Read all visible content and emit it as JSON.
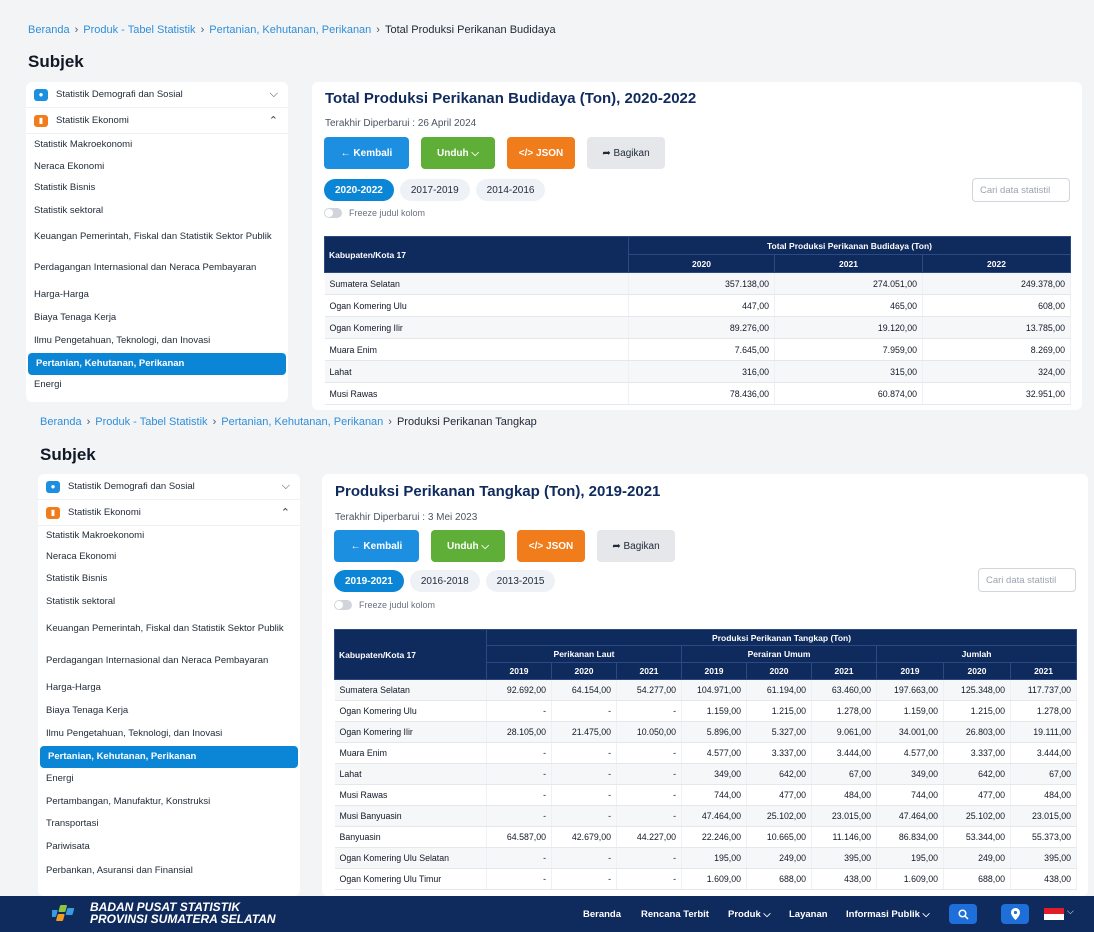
{
  "views": [
    {
      "breadcrumb": {
        "home": "Beranda",
        "products": "Produk - Tabel Statistik",
        "subject": "Pertanian, Kehutanan, Perikanan",
        "current": "Total Produksi Perikanan Budidaya"
      },
      "subject_heading": "Subjek",
      "sidebar": {
        "categories": [
          {
            "label": "Statistik Demografi dan Sosial",
            "icon": "people-icon",
            "chevron": "chevron-down-icon",
            "color": "#1d8fe0"
          },
          {
            "label": "Statistik Ekonomi",
            "icon": "chart-icon",
            "chevron": "chevron-up-icon",
            "color": "#f07c1b"
          }
        ],
        "items": [
          "Statistik Makroekonomi",
          "Neraca Ekonomi",
          "Statistik Bisnis",
          "Statistik sektoral",
          "Keuangan Pemerintah, Fiskal dan Statistik Sektor Publik",
          "Perdagangan Internasional dan Neraca Pembayaran",
          "Harga-Harga",
          "Biaya Tenaga Kerja",
          "Ilmu Pengetahuan, Teknologi, dan Inovasi",
          "Pertanian, Kehutanan, Perikanan",
          "Energi"
        ],
        "active_index": 9
      },
      "table_title": "Total Produksi Perikanan Budidaya (Ton), 2020-2022",
      "updated": "Terakhir Diperbarui : 26 April 2024",
      "buttons": {
        "back": "← Kembali",
        "download": "Unduh ⌵",
        "json": "</> JSON",
        "share": "➦ Bagikan"
      },
      "ranges": [
        "2020-2022",
        "2017-2019",
        "2014-2016"
      ],
      "freeze_label": "Freeze judul kolom",
      "search_placeholder": "Cari data statistil",
      "table": {
        "row_header": "Kabupaten/Kota 17",
        "group_header": "Total Produksi Perikanan Budidaya (Ton)",
        "years": [
          "2020",
          "2021",
          "2022"
        ],
        "rows": [
          [
            "Sumatera Selatan",
            "357.138,00",
            "274.051,00",
            "249.378,00"
          ],
          [
            "Ogan Komering Ulu",
            "447,00",
            "465,00",
            "608,00"
          ],
          [
            "Ogan Komering Ilir",
            "89.276,00",
            "19.120,00",
            "13.785,00"
          ],
          [
            "Muara Enim",
            "7.645,00",
            "7.959,00",
            "8.269,00"
          ],
          [
            "Lahat",
            "316,00",
            "315,00",
            "324,00"
          ],
          [
            "Musi Rawas",
            "78.436,00",
            "60.874,00",
            "32.951,00"
          ]
        ]
      }
    },
    {
      "breadcrumb": {
        "home": "Beranda",
        "products": "Produk - Tabel Statistik",
        "subject": "Pertanian, Kehutanan, Perikanan",
        "current": "Produksi Perikanan Tangkap"
      },
      "subject_heading": "Subjek",
      "sidebar": {
        "categories": [
          {
            "label": "Statistik Demografi dan Sosial",
            "icon": "people-icon",
            "chevron": "chevron-down-icon",
            "color": "#1d8fe0"
          },
          {
            "label": "Statistik Ekonomi",
            "icon": "chart-icon",
            "chevron": "chevron-up-icon",
            "color": "#f07c1b"
          }
        ],
        "items": [
          "Statistik Makroekonomi",
          "Neraca Ekonomi",
          "Statistik Bisnis",
          "Statistik sektoral",
          "Keuangan Pemerintah, Fiskal dan Statistik Sektor Publik",
          "Perdagangan Internasional dan Neraca Pembayaran",
          "Harga-Harga",
          "Biaya Tenaga Kerja",
          "Ilmu Pengetahuan, Teknologi, dan Inovasi",
          "Pertanian, Kehutanan, Perikanan",
          "Energi",
          "Pertambangan, Manufaktur, Konstruksi",
          "Transportasi",
          "Pariwisata",
          "Perbankan, Asuransi dan Finansial"
        ],
        "active_index": 9
      },
      "table_title": "Produksi Perikanan Tangkap (Ton), 2019-2021",
      "updated": "Terakhir Diperbarui : 3 Mei 2023",
      "buttons": {
        "back": "← Kembali",
        "download": "Unduh ⌵",
        "json": "</> JSON",
        "share": "➦ Bagikan"
      },
      "ranges": [
        "2019-2021",
        "2016-2018",
        "2013-2015"
      ],
      "freeze_label": "Freeze judul kolom",
      "search_placeholder": "Cari data statistil",
      "table": {
        "row_header": "Kabupaten/Kota 17",
        "group_header": "Produksi Perikanan Tangkap (Ton)",
        "subgroups": [
          "Perikanan Laut",
          "Perairan Umum",
          "Jumlah"
        ],
        "years": [
          "2019",
          "2020",
          "2021"
        ],
        "rows": [
          [
            "Sumatera Selatan",
            "92.692,00",
            "64.154,00",
            "54.277,00",
            "104.971,00",
            "61.194,00",
            "63.460,00",
            "197.663,00",
            "125.348,00",
            "117.737,00"
          ],
          [
            "Ogan Komering Ulu",
            "-",
            "-",
            "-",
            "1.159,00",
            "1.215,00",
            "1.278,00",
            "1.159,00",
            "1.215,00",
            "1.278,00"
          ],
          [
            "Ogan Komering Ilir",
            "28.105,00",
            "21.475,00",
            "10.050,00",
            "5.896,00",
            "5.327,00",
            "9.061,00",
            "34.001,00",
            "26.803,00",
            "19.111,00"
          ],
          [
            "Muara Enim",
            "-",
            "-",
            "-",
            "4.577,00",
            "3.337,00",
            "3.444,00",
            "4.577,00",
            "3.337,00",
            "3.444,00"
          ],
          [
            "Lahat",
            "-",
            "-",
            "-",
            "349,00",
            "642,00",
            "67,00",
            "349,00",
            "642,00",
            "67,00"
          ],
          [
            "Musi Rawas",
            "-",
            "-",
            "-",
            "744,00",
            "477,00",
            "484,00",
            "744,00",
            "477,00",
            "484,00"
          ],
          [
            "Musi Banyuasin",
            "-",
            "-",
            "-",
            "47.464,00",
            "25.102,00",
            "23.015,00",
            "47.464,00",
            "25.102,00",
            "23.015,00"
          ],
          [
            "Banyuasin",
            "64.587,00",
            "42.679,00",
            "44.227,00",
            "22.246,00",
            "10.665,00",
            "11.146,00",
            "86.834,00",
            "53.344,00",
            "55.373,00"
          ],
          [
            "Ogan Komering Ulu Selatan",
            "-",
            "-",
            "-",
            "195,00",
            "249,00",
            "395,00",
            "195,00",
            "249,00",
            "395,00"
          ],
          [
            "Ogan Komering Ulu Timur",
            "-",
            "-",
            "-",
            "1.609,00",
            "688,00",
            "438,00",
            "1.609,00",
            "688,00",
            "438,00"
          ]
        ]
      }
    }
  ],
  "footer": {
    "brand_line1": "BADAN PUSAT STATISTIK",
    "brand_line2": "PROVINSI SUMATERA SELATAN",
    "nav": [
      "Beranda",
      "Rencana Terbit",
      "Produk ⌵",
      "Layanan",
      "Informasi Publik ⌵"
    ],
    "icons": [
      "search-icon",
      "location-icon",
      "flag-id-icon"
    ],
    "accent": "#0f2a5c"
  }
}
